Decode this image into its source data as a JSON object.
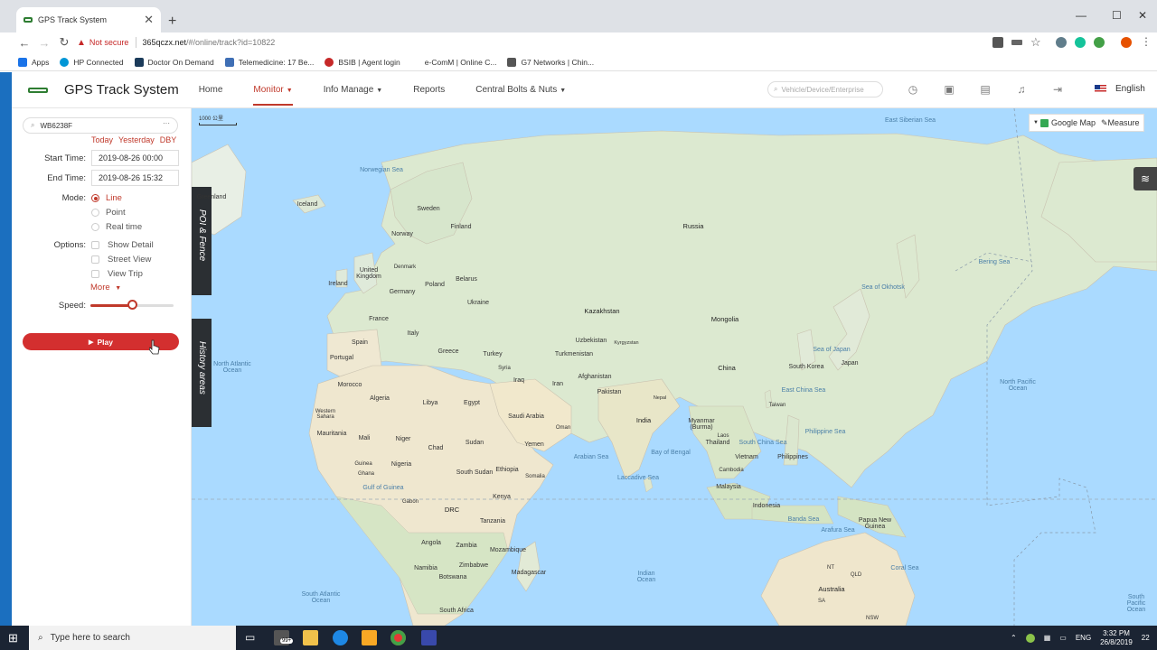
{
  "browser": {
    "tab_title": "GPS Track System",
    "new_tab": "+",
    "url_warning": "Not secure",
    "url_host": "365qczx.net",
    "url_path": "/#/online/track?id=10822",
    "controls": {
      "minimize": "—",
      "maximize": "☐",
      "close": "✕"
    },
    "bookmarks": [
      {
        "label": "Apps",
        "color": "#1a73e8"
      },
      {
        "label": "HP Connected",
        "color": "#0096d6"
      },
      {
        "label": "Doctor On Demand",
        "color": "#1b3b5a"
      },
      {
        "label": "Telemedicine: 17 Be...",
        "color": "#3f6fb5"
      },
      {
        "label": "BSIB | Agent login",
        "color": "#c62828"
      },
      {
        "label": "e-ComM | Online C...",
        "color": "#ffffff"
      },
      {
        "label": "G7 Networks | Chin...",
        "color": "#555555"
      }
    ]
  },
  "app": {
    "title": "GPS Track System",
    "nav": [
      {
        "label": "Home",
        "caret": false,
        "active": false
      },
      {
        "label": "Monitor",
        "caret": true,
        "active": true
      },
      {
        "label": "Info Manage",
        "caret": true,
        "active": false
      },
      {
        "label": "Reports",
        "caret": false,
        "active": false
      },
      {
        "label": "Central Bolts & Nuts",
        "caret": true,
        "active": false
      }
    ],
    "search_placeholder": "Vehicle/Device/Enterprise",
    "language": "English",
    "accent": "#c0392b"
  },
  "track_panel": {
    "vehicle": "WB6238F",
    "quick": [
      "Today",
      "Yesterday",
      "DBY"
    ],
    "start_label": "Start Time:",
    "start_value": "2019-08-26 00:00",
    "end_label": "End Time:",
    "end_value": "2019-08-26 15:32",
    "mode_label": "Mode:",
    "modes": [
      {
        "label": "Line",
        "selected": true
      },
      {
        "label": "Point",
        "selected": false
      },
      {
        "label": "Real time",
        "selected": false
      }
    ],
    "options_label": "Options:",
    "options": [
      {
        "label": "Show Detail",
        "checked": false
      },
      {
        "label": "Street View",
        "checked": false
      },
      {
        "label": "View Trip",
        "checked": false
      }
    ],
    "more": "More",
    "speed_label": "Speed:",
    "speed_level": 0.5,
    "play": "Play"
  },
  "map": {
    "scale": "1000 公里",
    "provider": "Google Map",
    "measure": "Measure",
    "side_tabs": [
      "POI & Fence",
      "History areas"
    ],
    "labels": {
      "seas": [
        "Norwegian Sea",
        "East Siberian Sea",
        "Sea of Okhotsk",
        "Bering Sea",
        "Sea of Japan",
        "East China Sea",
        "Philippine Sea",
        "South China Sea",
        "Bay of Bengal",
        "Arabian Sea",
        "Laccadive Sea",
        "Gulf of Guinea",
        "Banda Sea",
        "Arafura Sea",
        "Coral Sea",
        "North Atlantic Ocean",
        "South Atlantic Ocean",
        "Indian Ocean",
        "North Pacific Ocean",
        "South Pacific Ocean"
      ],
      "countries": [
        "Greenland",
        "Iceland",
        "Sweden",
        "Finland",
        "Norway",
        "Russia",
        "United Kingdom",
        "Denmark",
        "Ireland",
        "Poland",
        "Belarus",
        "Germany",
        "Ukraine",
        "France",
        "Italy",
        "Spain",
        "Portugal",
        "Greece",
        "Turkey",
        "Kazakhstan",
        "Uzbekistan",
        "Kyrgyzstan",
        "Turkmenistan",
        "Mongolia",
        "China",
        "South Korea",
        "Japan",
        "Syria",
        "Iraq",
        "Iran",
        "Afghanistan",
        "Pakistan",
        "Nepal",
        "India",
        "Morocco",
        "Algeria",
        "Libya",
        "Egypt",
        "Saudi Arabia",
        "Oman",
        "Western Sahara",
        "Mauritania",
        "Mali",
        "Niger",
        "Chad",
        "Sudan",
        "Yemen",
        "Myanmar (Burma)",
        "Thailand",
        "Vietnam",
        "Philippines",
        "Taiwan",
        "Laos",
        "Cambodia",
        "Malaysia",
        "Indonesia",
        "Papua New Guinea",
        "Guinea",
        "Nigeria",
        "Ghana",
        "Gabon",
        "South Sudan",
        "Ethiopia",
        "Somalia",
        "Kenya",
        "DRC",
        "Tanzania",
        "Angola",
        "Zambia",
        "Mozambique",
        "Namibia",
        "Zimbabwe",
        "Botswana",
        "Madagascar",
        "South Africa",
        "Australia",
        "NT",
        "QLD",
        "SA",
        "NSW"
      ]
    }
  },
  "taskbar": {
    "search": "Type here to search",
    "badge": "99+",
    "lang": "ENG",
    "time": "3:32 PM",
    "date": "26/8/2019",
    "notifications": "22"
  }
}
